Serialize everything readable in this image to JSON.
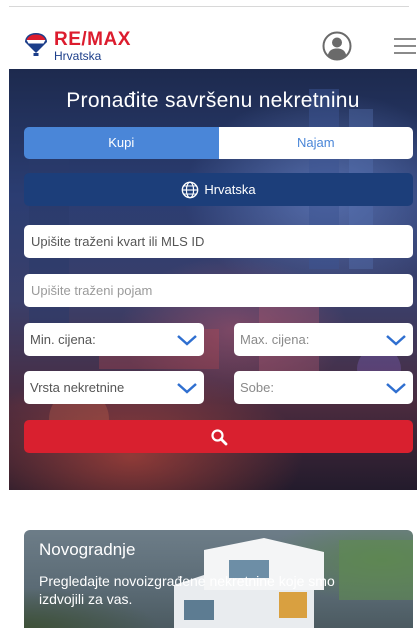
{
  "header": {
    "brand": "RE/MAX",
    "brand_left": "RE",
    "brand_right": "MAX",
    "region": "Hrvatska",
    "user_icon": "user-circle-icon",
    "menu_icon": "hamburger-menu-icon"
  },
  "hero": {
    "title": "Pronađite savršenu nekretninu",
    "tabs": [
      {
        "label": "Kupi",
        "active": true
      },
      {
        "label": "Najam",
        "active": false
      }
    ],
    "country_label": "Hrvatska",
    "country_icon": "globe-icon",
    "search_district_placeholder": "Upišite traženi kvart ili MLS ID",
    "search_term_placeholder": "Upišite traženi pojam",
    "min_price_label": "Min. cijena:",
    "max_price_label": "Max. cijena:",
    "property_type_label": "Vrsta nekretnine",
    "rooms_label": "Sobe:",
    "search_button_icon": "search-icon"
  },
  "card": {
    "title": "Novogradnje",
    "text": "Pregledajte novoizgrađene nekretnine koje smo izdvojili za vas."
  },
  "colors": {
    "brand_red": "#dc1c2e",
    "brand_blue": "#1c3e8a",
    "tab_active": "#4a86d8",
    "country_bar": "#1c3e7a",
    "search_button": "#d9202f"
  }
}
